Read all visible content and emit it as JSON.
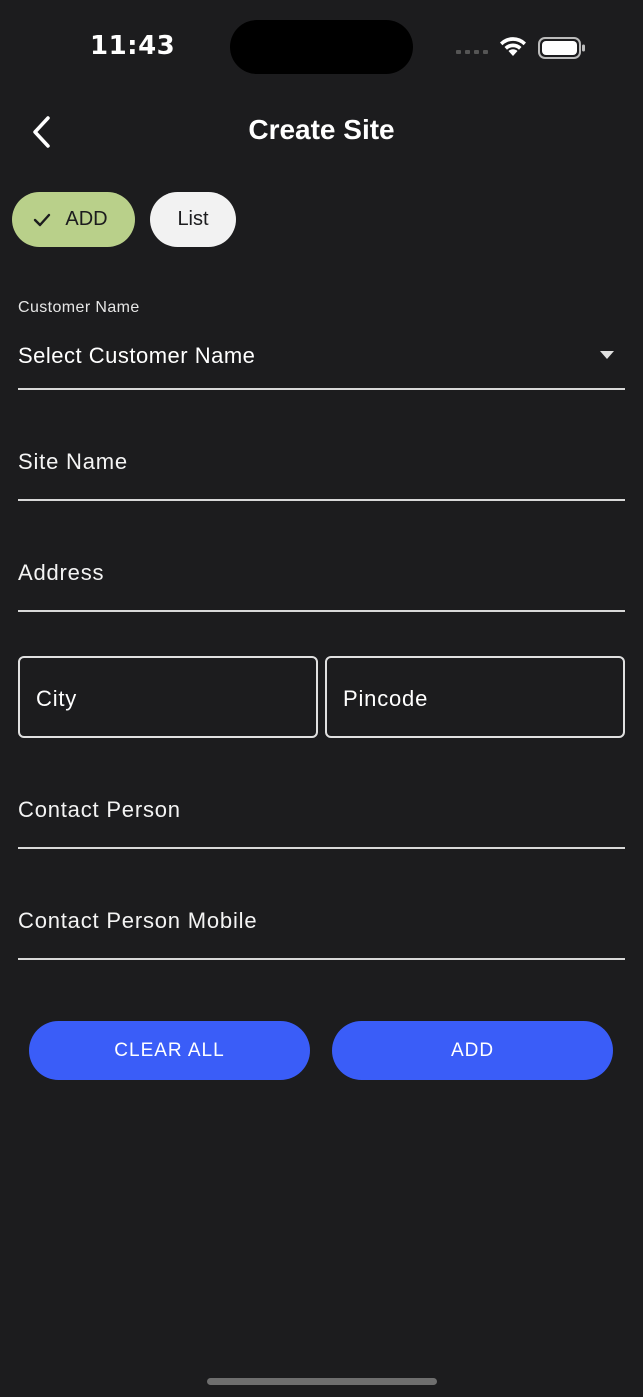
{
  "status_bar": {
    "time": "11:43"
  },
  "header": {
    "title": "Create Site",
    "back_icon": "chevron-left-icon"
  },
  "segments": {
    "add_label": "ADD",
    "list_label": "List",
    "selected": "ADD"
  },
  "form": {
    "customer_label": "Customer Name",
    "customer_value": "Select Customer Name",
    "site_name": "Site Name",
    "address": "Address",
    "city": "City",
    "pincode": "Pincode",
    "contact_person": "Contact Person",
    "contact_mobile": "Contact Person Mobile"
  },
  "actions": {
    "clear_label": "CLEAR ALL",
    "add_label": "ADD"
  },
  "colors": {
    "background": "#1c1c1e",
    "accent_button": "#3a5df8",
    "chip_selected": "#b9d08a",
    "chip_unselected": "#f2f2f2"
  }
}
